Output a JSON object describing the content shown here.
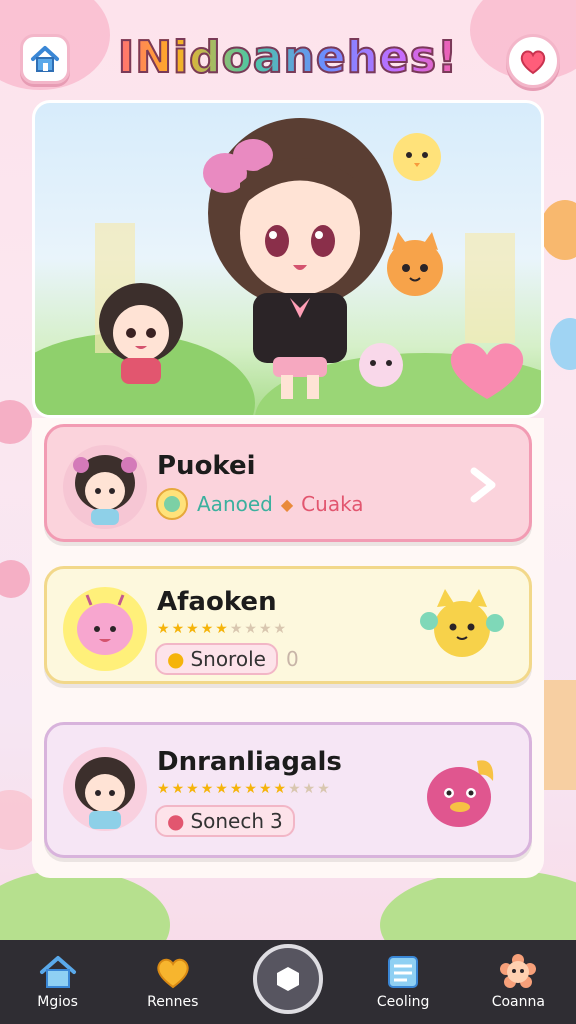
{
  "app": {
    "title": "INidoanehes!"
  },
  "header": {
    "home_icon": "home-icon",
    "heart_icon": "heart-icon"
  },
  "characters": [
    {
      "name": "Puokei",
      "detail": "Aanoed",
      "detail2": "Cuaka",
      "stars_filled": 0,
      "card_color": "#fbd3dc",
      "border_color": "#f29bb3"
    },
    {
      "name": "Afaoken",
      "stars_filled": 5,
      "stars_total": 9,
      "pill_text": "Snorole",
      "count": "0",
      "card_color": "#fdf8dd",
      "border_color": "#f2d88a"
    },
    {
      "name": "Dnranliagals",
      "stars_filled": 9,
      "stars_total": 12,
      "pill_text": "Sonech",
      "count": "3",
      "card_color": "#f6e6f5",
      "border_color": "#d8b3dc"
    }
  ],
  "nav": {
    "items": [
      {
        "label": "Mgios",
        "icon": "home-icon"
      },
      {
        "label": "Rennes",
        "icon": "heart-icon"
      },
      {
        "label": "",
        "icon": "center-hexagon-icon"
      },
      {
        "label": "Ceoling",
        "icon": "notebook-icon"
      },
      {
        "label": "Coanna",
        "icon": "flower-face-icon"
      }
    ]
  },
  "colors": {
    "accent_pink": "#f29bb3",
    "nav_bg": "#2f2d33"
  }
}
